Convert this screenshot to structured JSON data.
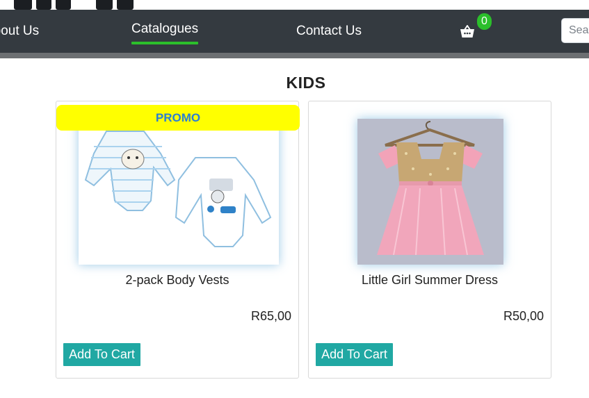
{
  "nav": {
    "items": [
      {
        "label": "About Us",
        "active": false
      },
      {
        "label": "Catalogues",
        "active": true
      },
      {
        "label": "Contact Us",
        "active": false
      }
    ],
    "cart_icon": "basket-icon",
    "cart_count": "0",
    "search_placeholder": "Search"
  },
  "section": {
    "title": "KIDS"
  },
  "products": [
    {
      "name": "2-pack Body Vests",
      "price": "R65,00",
      "promo": "PROMO",
      "button": "Add To Cart"
    },
    {
      "name": "Little Girl Summer Dress",
      "price": "R50,00",
      "button": "Add To Cart"
    }
  ],
  "colors": {
    "navbar": "#343a40",
    "active_underline": "#2bbf2b",
    "badge": "#2bbf2b",
    "promo_bg": "#ffff00",
    "promo_text": "#2a7fd4",
    "button": "#20a8a3"
  }
}
